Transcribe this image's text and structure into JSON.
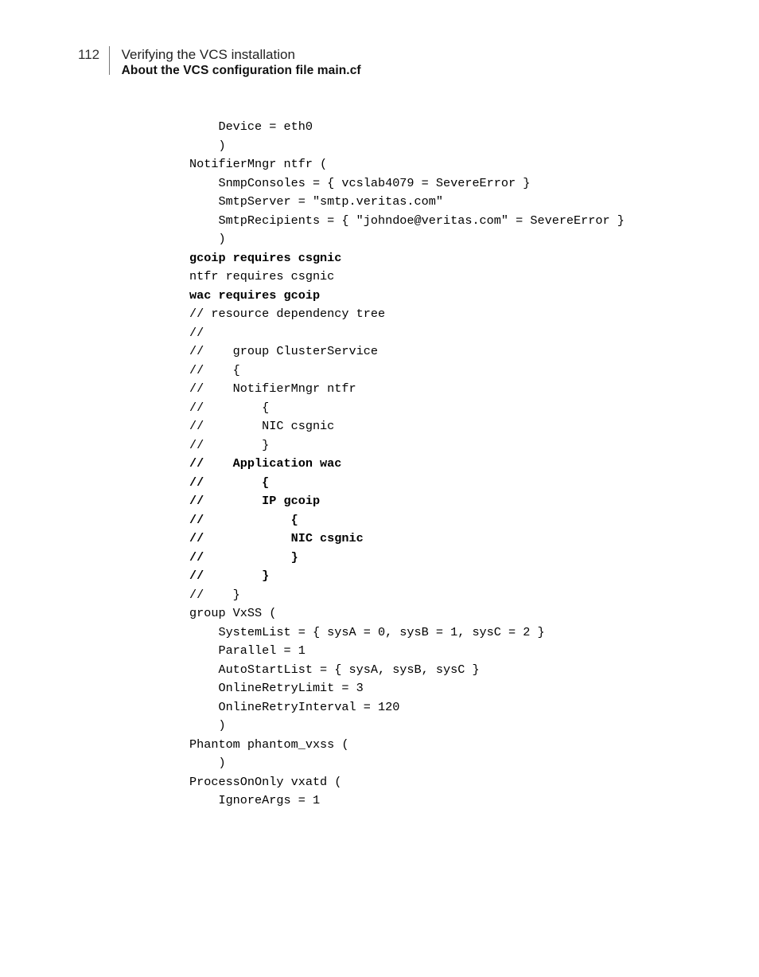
{
  "header": {
    "page_number": "112",
    "chapter": "Verifying the VCS installation",
    "section": "About the VCS configuration file main.cf"
  },
  "code": {
    "l01": "    Device = eth0",
    "l02": "    )",
    "l03": "",
    "l04": "NotifierMngr ntfr (",
    "l05": "    SnmpConsoles = { vcslab4079 = SevereError }",
    "l06": "    SmtpServer = \"smtp.veritas.com\"",
    "l07": "    SmtpRecipients = { \"johndoe@veritas.com\" = SevereError }",
    "l08": "    )",
    "l09": "",
    "l10": "gcoip requires csgnic",
    "l11": "ntfr requires csgnic",
    "l12": "wac requires gcoip",
    "l13": "",
    "l14": "// resource dependency tree",
    "l15": "//",
    "l16": "//    group ClusterService",
    "l17": "//    {",
    "l18": "//    NotifierMngr ntfr",
    "l19": "//        {",
    "l20": "//        NIC csgnic",
    "l21": "//        }",
    "l22": "//    Application wac",
    "l23": "//        {",
    "l24": "//        IP gcoip",
    "l25": "//            {",
    "l26": "//            NIC csgnic",
    "l27": "//            }",
    "l28": "//        }",
    "l29": "//    }",
    "l30": "",
    "l31": "group VxSS (",
    "l32": "    SystemList = { sysA = 0, sysB = 1, sysC = 2 }",
    "l33": "    Parallel = 1",
    "l34": "    AutoStartList = { sysA, sysB, sysC }",
    "l35": "    OnlineRetryLimit = 3",
    "l36": "    OnlineRetryInterval = 120",
    "l37": "    )",
    "l38": "",
    "l39": "Phantom phantom_vxss (",
    "l40": "    )",
    "l41": "",
    "l42": "ProcessOnOnly vxatd (",
    "l43": "    IgnoreArgs = 1"
  }
}
